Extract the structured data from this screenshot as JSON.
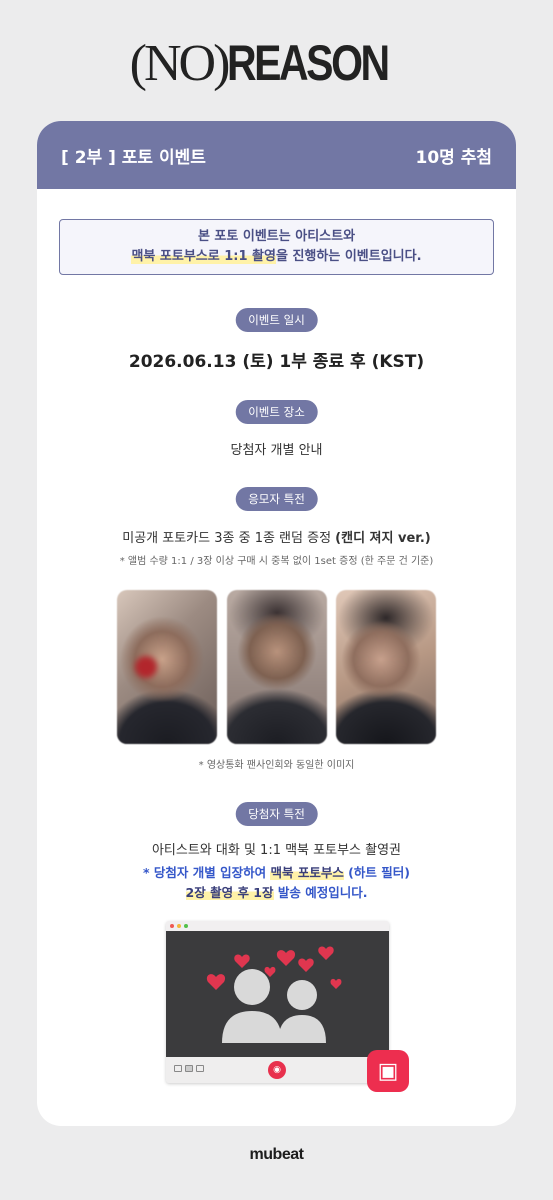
{
  "logo": {
    "paren_text": "(NO)",
    "word": "REASON"
  },
  "header": {
    "title": "[ 2부 ] 포토 이벤트",
    "winners": "10명 추첨"
  },
  "notice": {
    "line1": "본 포토 이벤트는 아티스트와",
    "line2_highlight": "맥북 포토부스로 1:1 촬영",
    "line2_rest": "을 진행하는 이벤트입니다."
  },
  "event_date": {
    "label": "이벤트 일시",
    "value": "2026.06.13 (토) 1부 종료 후 (KST)"
  },
  "event_place": {
    "label": "이벤트 장소",
    "value": "당첨자 개별 안내"
  },
  "applicant_benefit": {
    "label": "응모자 특전",
    "desc_main": "미공개 포토카드 3종 중 1종 랜덤 증정 ",
    "desc_bold": "(캔디 져지 ver.)",
    "note": "* 앨범 수량 1:1 / 3장 이상 구매 시 중복 없이 1set 증정 (한 주문 건 기준)",
    "photo_caption": "*  영상통화 팬사인회와 동일한 이미지"
  },
  "winner_benefit": {
    "label": "당첨자 특전",
    "desc": "아티스트와 대화 및 1:1 맥북 포토부스 촬영권",
    "note1_prefix": "* 당첨자 개별 입장하여 ",
    "note1_highlight": "맥북 포토부스",
    "note1_suffix": " (하트 필터)",
    "note2_highlight": "2장 촬영 후 1장",
    "note2_suffix": " 발송 예정입니다."
  },
  "icons": [
    "camera-shutter-icon",
    "photobooth-app-icon",
    "heart-icon",
    "person-icon"
  ],
  "colors": {
    "accent": "#7277a4",
    "highlight": "#fff2a8",
    "blue_text": "#3557c9",
    "heart": "#e0364f"
  },
  "footer": {
    "brand": "mubeat"
  }
}
